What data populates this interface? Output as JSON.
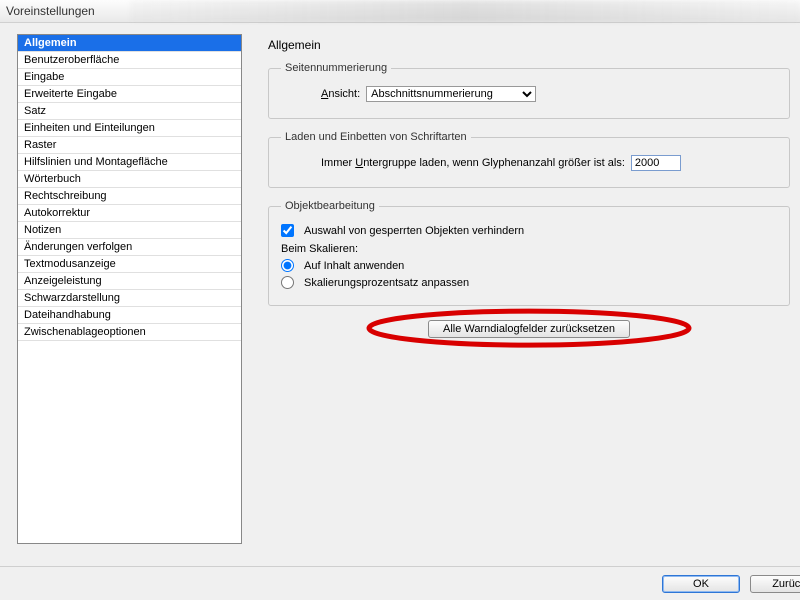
{
  "window": {
    "title": "Voreinstellungen"
  },
  "sidebar": {
    "items": [
      "Allgemein",
      "Benutzeroberfläche",
      "Eingabe",
      "Erweiterte Eingabe",
      "Satz",
      "Einheiten und Einteilungen",
      "Raster",
      "Hilfslinien und Montagefläche",
      "Wörterbuch",
      "Rechtschreibung",
      "Autokorrektur",
      "Notizen",
      "Änderungen verfolgen",
      "Textmodusanzeige",
      "Anzeigeleistung",
      "Schwarzdarstellung",
      "Dateihandhabung",
      "Zwischenablageoptionen"
    ],
    "selected_index": 0
  },
  "page": {
    "title": "Allgemein",
    "section_page_numbering": {
      "legend": "Seitennummerierung",
      "view_label_pre": "A",
      "view_label_post": "nsicht:",
      "view_value": "Abschnittsnummerierung"
    },
    "section_fonts": {
      "legend": "Laden und Einbetten von Schriftarten",
      "line_pre": "Immer ",
      "line_u": "U",
      "line_mid": "ntergruppe laden, wenn Glyphenanzahl größer ist als:",
      "threshold": "2000"
    },
    "section_object": {
      "legend": "Objektbearbeitung",
      "lock_checkbox_label": "Auswahl von gesperrten Objekten verhindern",
      "lock_checked": true,
      "scaling_header": "Beim Skalieren:",
      "radio_content": "Auf Inhalt anwenden",
      "radio_percent": "Skalierungsprozentsatz anpassen",
      "radio_selected": "content"
    },
    "reset_button": "Alle Warndialogfelder zurücksetzen"
  },
  "footer": {
    "ok": "OK",
    "back": "Zurück"
  }
}
